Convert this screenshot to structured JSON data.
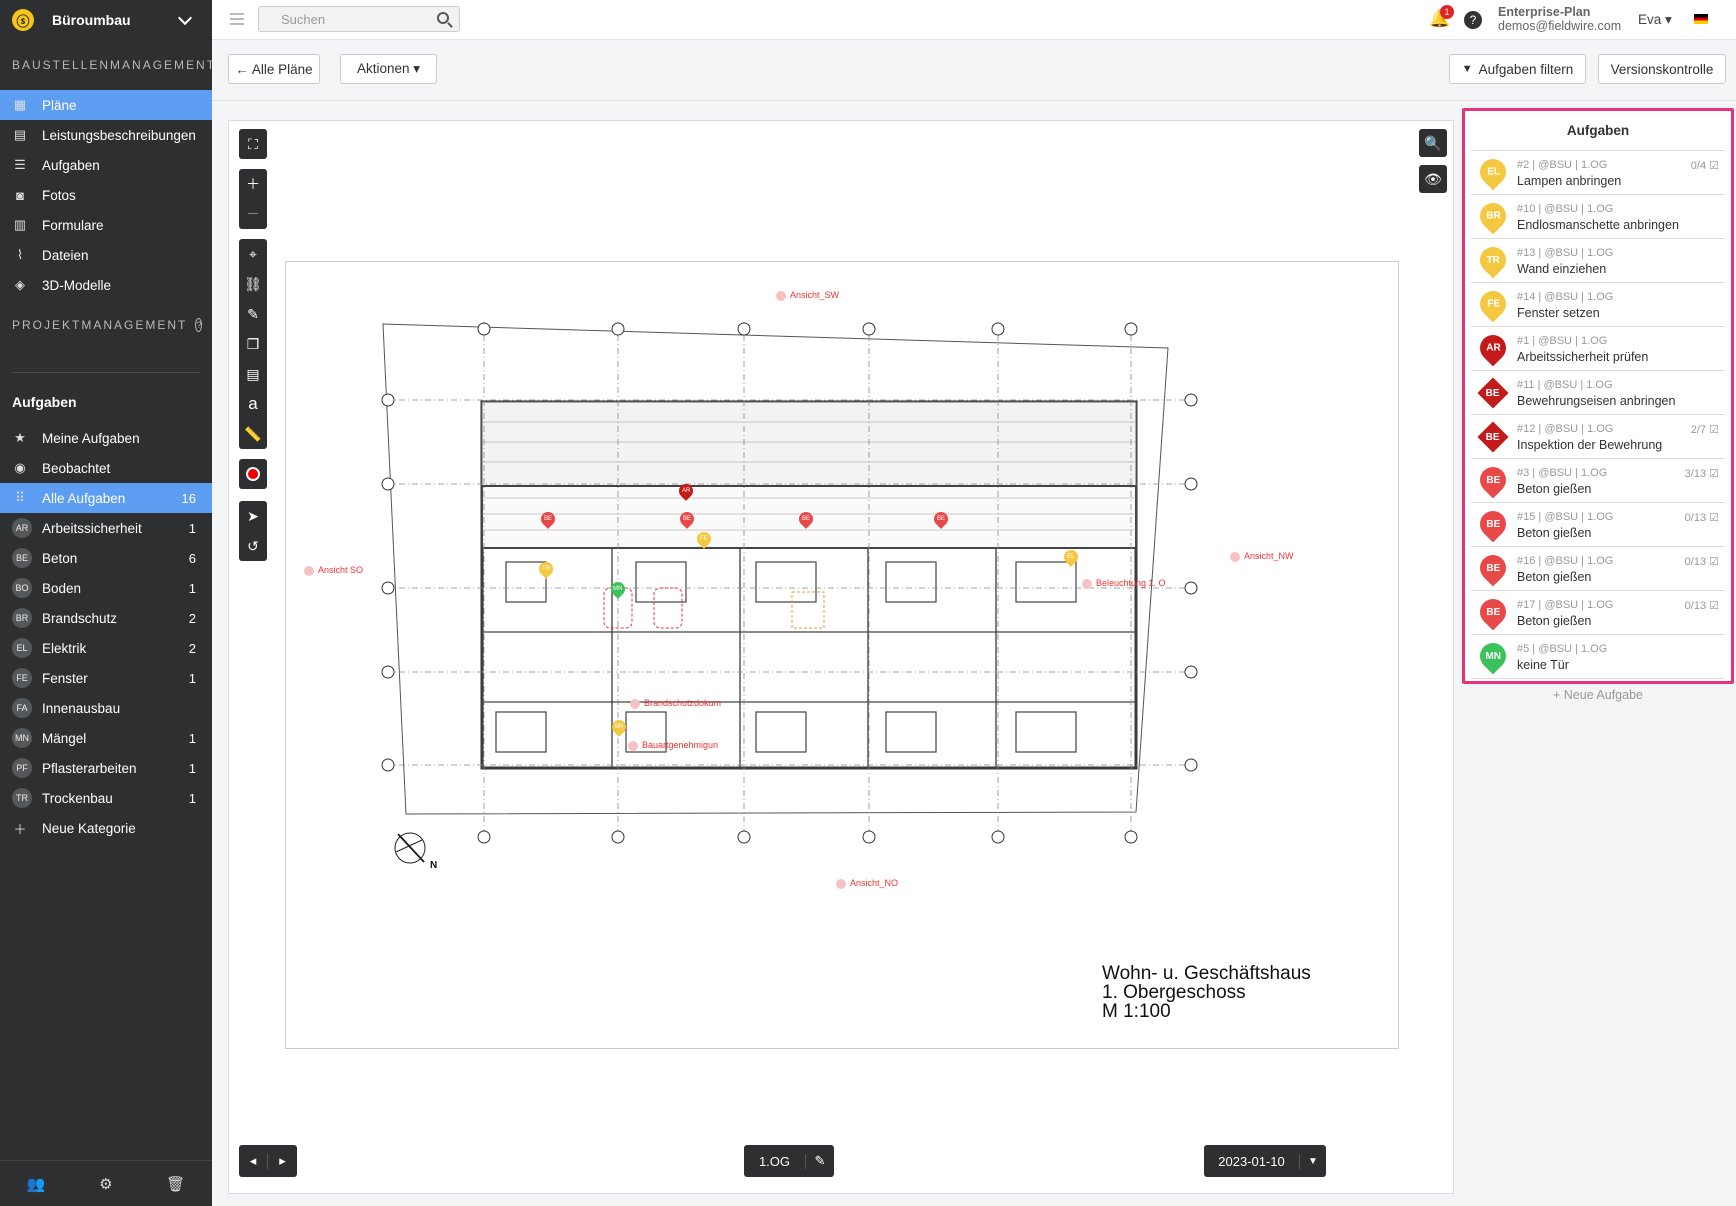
{
  "sidebar": {
    "project": "Büroumbau",
    "logo_glyph": "ⓢ",
    "section_construction": "BAUSTELLENMANAGEMENT",
    "nav": [
      {
        "label": "Pläne",
        "icon": "plans-icon",
        "active": true
      },
      {
        "label": "Leistungsbeschreibungen",
        "icon": "specs-icon"
      },
      {
        "label": "Aufgaben",
        "icon": "list-icon"
      },
      {
        "label": "Fotos",
        "icon": "camera-icon"
      },
      {
        "label": "Formulare",
        "icon": "clipboard-icon"
      },
      {
        "label": "Dateien",
        "icon": "paperclip-icon"
      },
      {
        "label": "3D-Modelle",
        "icon": "cube-icon"
      }
    ],
    "section_project": "PROJEKTMANAGEMENT",
    "tasks_heading": "Aufgaben",
    "filters": [
      {
        "label": "Meine Aufgaben",
        "icon": "star-icon"
      },
      {
        "label": "Beobachtet",
        "icon": "eye-icon"
      },
      {
        "label": "Alle Aufgaben",
        "icon": "grid-icon",
        "count": "16",
        "active": true
      }
    ],
    "categories": [
      {
        "abbr": "AR",
        "label": "Arbeitssicherheit",
        "count": "1"
      },
      {
        "abbr": "BE",
        "label": "Beton",
        "count": "6"
      },
      {
        "abbr": "BO",
        "label": "Boden",
        "count": "1"
      },
      {
        "abbr": "BR",
        "label": "Brandschutz",
        "count": "2"
      },
      {
        "abbr": "EL",
        "label": "Elektrik",
        "count": "2"
      },
      {
        "abbr": "FE",
        "label": "Fenster",
        "count": "1"
      },
      {
        "abbr": "FA",
        "label": "Innenausbau",
        "count": ""
      },
      {
        "abbr": "MN",
        "label": "Mängel",
        "count": "1"
      },
      {
        "abbr": "PF",
        "label": "Pflasterarbeiten",
        "count": "1"
      },
      {
        "abbr": "TR",
        "label": "Trockenbau",
        "count": "1"
      }
    ],
    "new_category": "Neue Kategorie"
  },
  "topbar": {
    "search_placeholder": "Suchen",
    "notifications": "1",
    "plan": "Enterprise-Plan",
    "email": "demos@fieldwire.com",
    "user": "Eva ▾"
  },
  "toolbar": {
    "all_plans": "← Alle Pläne",
    "actions": "Aktionen ▾",
    "filter_tasks": "Aufgaben filtern",
    "version_control": "Versionskontrolle"
  },
  "viewer": {
    "labels": {
      "sw": "Ansicht_SW",
      "so": "Ansicht SO",
      "nw": "Ansicht_NW",
      "no": "Ansicht_NO",
      "beleuchtung": "Beleuchtung 1. O",
      "brandschutz": "Brandschutzdokum",
      "bauantrag": "Bauartgenehmigun"
    },
    "title_lines": [
      "Wohn- u. Geschäftshaus",
      "1. Obergeschoss",
      "M 1:100"
    ],
    "compass": "N",
    "floor": "1.OG",
    "date": "2023-01-10"
  },
  "panel": {
    "heading": "Aufgaben",
    "tasks": [
      {
        "abbr": "EL",
        "color": "#f5c842",
        "shape": "drop",
        "meta": "#2 | @BSU | 1.OG",
        "title": "Lampen anbringen",
        "progress": "0/4"
      },
      {
        "abbr": "BR",
        "color": "#f5c842",
        "shape": "drop",
        "meta": "#10 | @BSU | 1.OG",
        "title": "Endlosmanschette anbringen",
        "progress": ""
      },
      {
        "abbr": "TR",
        "color": "#f5c842",
        "shape": "drop",
        "meta": "#13 | @BSU | 1.OG",
        "title": "Wand einziehen",
        "progress": ""
      },
      {
        "abbr": "FE",
        "color": "#f5c842",
        "shape": "drop",
        "meta": "#14 | @BSU | 1.OG",
        "title": "Fenster setzen",
        "progress": ""
      },
      {
        "abbr": "AR",
        "color": "#c41a1a",
        "shape": "drop",
        "meta": "#1 | @BSU | 1.OG",
        "title": "Arbeitssicherheit prüfen",
        "progress": ""
      },
      {
        "abbr": "BE",
        "color": "#c41a1a",
        "shape": "dia",
        "meta": "#11 | @BSU | 1.OG",
        "title": "Bewehrungseisen anbringen",
        "progress": ""
      },
      {
        "abbr": "BE",
        "color": "#c41a1a",
        "shape": "dia",
        "meta": "#12 | @BSU | 1.OG",
        "title": "Inspektion der Bewehrung",
        "progress": "2/7"
      },
      {
        "abbr": "BE",
        "color": "#e84848",
        "shape": "drop",
        "meta": "#3 | @BSU | 1.OG",
        "title": "Beton gießen",
        "progress": "3/13"
      },
      {
        "abbr": "BE",
        "color": "#e84848",
        "shape": "drop",
        "meta": "#15 | @BSU | 1.OG",
        "title": "Beton gießen",
        "progress": "0/13"
      },
      {
        "abbr": "BE",
        "color": "#e84848",
        "shape": "drop",
        "meta": "#16 | @BSU | 1.OG",
        "title": "Beton gießen",
        "progress": "0/13"
      },
      {
        "abbr": "BE",
        "color": "#e84848",
        "shape": "drop",
        "meta": "#17 | @BSU | 1.OG",
        "title": "Beton gießen",
        "progress": "0/13"
      },
      {
        "abbr": "MN",
        "color": "#3cc25a",
        "shape": "drop",
        "meta": "#5 | @BSU | 1.OG",
        "title": "keine Tür",
        "progress": ""
      }
    ],
    "new_task": "+ Neue Aufgabe"
  },
  "colors": {
    "accent": "#5d9ef2",
    "sidebar": "#2d2f31",
    "highlight": "#e8327a"
  }
}
